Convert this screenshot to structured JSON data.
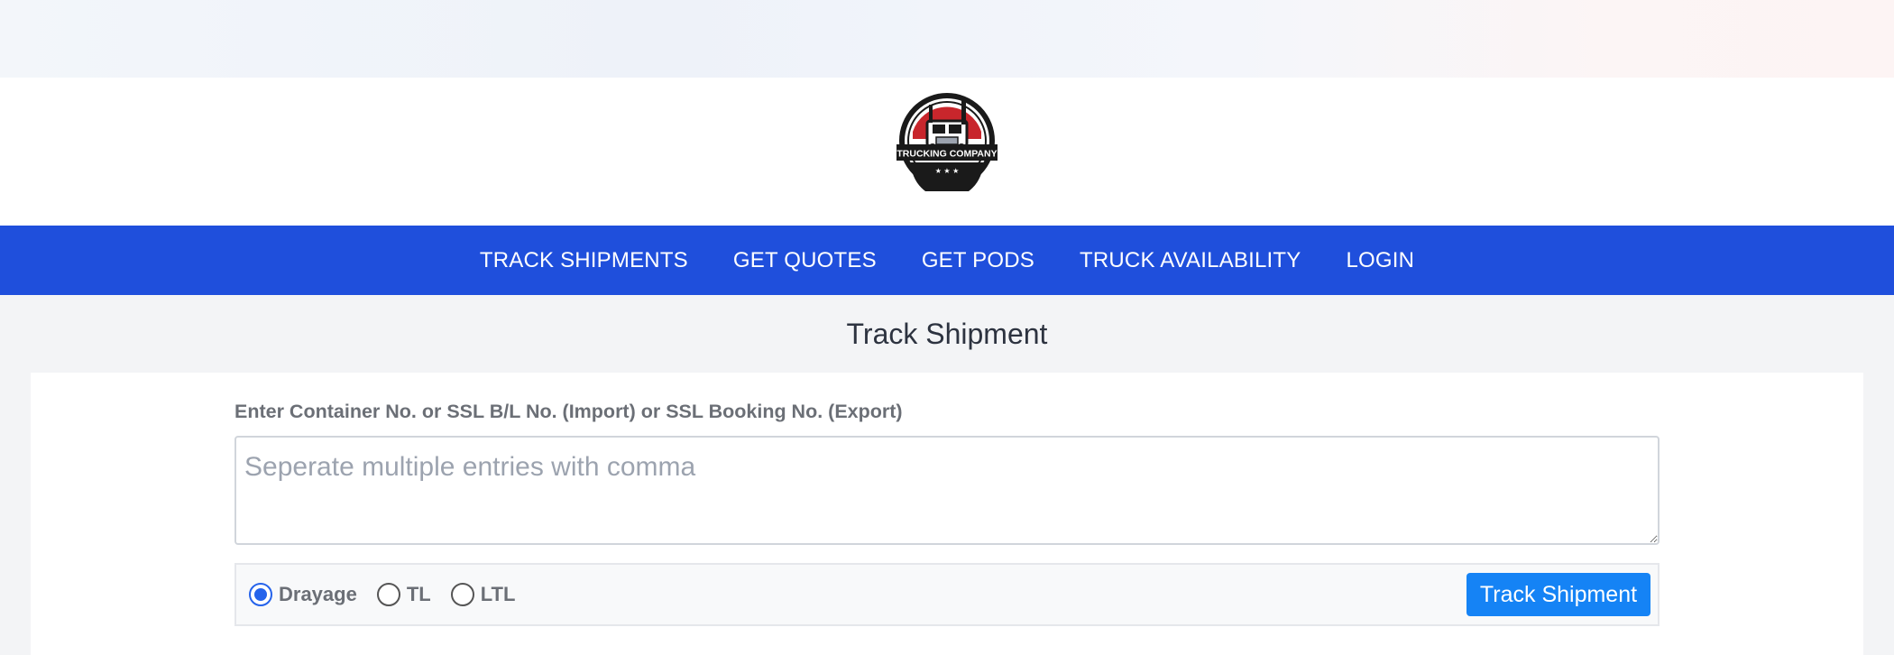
{
  "brand": {
    "logo_text": "TRUCKING COMPANY",
    "logo_stars": "★ ★ ★"
  },
  "nav": {
    "items": [
      {
        "label": "TRACK SHIPMENTS"
      },
      {
        "label": "GET QUOTES"
      },
      {
        "label": "GET PODS"
      },
      {
        "label": "TRUCK AVAILABILITY"
      },
      {
        "label": "LOGIN"
      }
    ]
  },
  "main": {
    "title": "Track Shipment",
    "field_label": "Enter Container No. or SSL B/L No. (Import) or SSL Booking No. (Export)",
    "input_value": "",
    "input_placeholder": "Seperate multiple entries with comma",
    "options": [
      {
        "label": "Drayage",
        "checked": true
      },
      {
        "label": "TL",
        "checked": false
      },
      {
        "label": "LTL",
        "checked": false
      }
    ],
    "submit_label": "Track Shipment"
  },
  "colors": {
    "nav_bg": "#1f4fdc",
    "button_bg": "#1583f5",
    "radio_accent": "#2563eb",
    "logo_red": "#c8262c"
  },
  "icons": {
    "logo": "truck-badge-icon",
    "radio": "radio-button-icon",
    "resize": "resize-handle-icon"
  }
}
